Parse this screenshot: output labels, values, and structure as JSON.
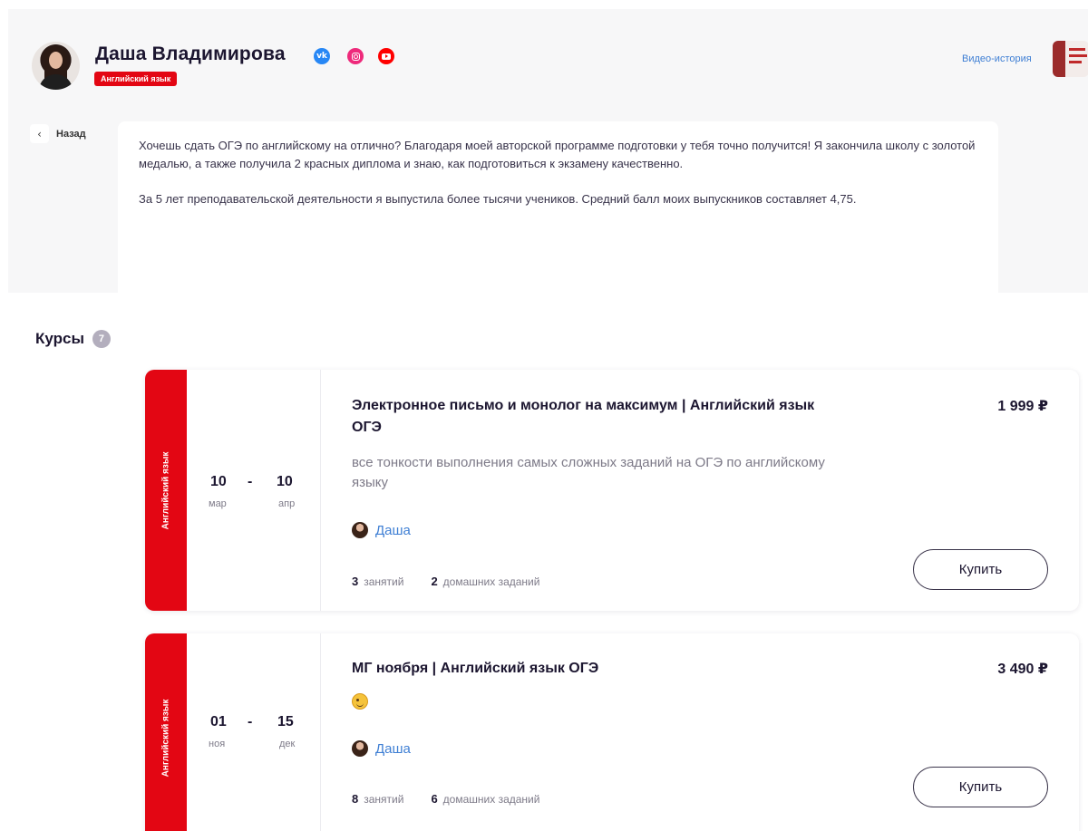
{
  "profile": {
    "name": "Даша Владимирова",
    "subject_tag": "Английский язык",
    "video_link": "Видео-история",
    "back_label": "Назад",
    "socials": [
      {
        "icon": "vk-icon",
        "color": "#2787f5"
      },
      {
        "icon": "instagram-icon",
        "color": "#ee2a7b"
      },
      {
        "icon": "youtube-icon",
        "color": "#ff0000"
      }
    ],
    "bio": [
      "Хочешь сдать ОГЭ по английскому на отлично? Благодаря моей авторской программе подготовки у тебя точно получится! Я закончила школу с золотой медалью, а также получила 2 красных диплома и знаю, как подготовиться к экзамену качественно.",
      "За 5 лет преподавательской деятельности я выпустила более тысячи учеников. Средний балл моих выпускников составляет 4,75."
    ]
  },
  "courses": {
    "title": "Курсы",
    "count": "7",
    "items": [
      {
        "subject": "Английский язык",
        "start_day": "10",
        "start_month": "мар",
        "dash": "-",
        "end_day": "10",
        "end_month": "апр",
        "title": "Электронное письмо и монолог на максимум | Английский язык ОГЭ",
        "price": "1 999 ₽",
        "description": "все тонкости выполнения самых сложных заданий на ОГЭ по английскому языку",
        "author": "Даша",
        "lessons_count": "3",
        "lessons_label": "занятий",
        "homework_count": "2",
        "homework_label": "домашних заданий",
        "buy_label": "Купить"
      },
      {
        "subject": "Английский язык",
        "start_day": "01",
        "start_month": "ноя",
        "dash": "-",
        "end_day": "15",
        "end_month": "дек",
        "title": "МГ ноября | Английский язык ОГЭ",
        "price": "3 490 ₽",
        "description_icon": "winking-face-emoji",
        "author": "Даша",
        "lessons_count": "8",
        "lessons_label": "занятий",
        "homework_count": "6",
        "homework_label": "домашних заданий",
        "buy_label": "Купить"
      }
    ]
  },
  "colors": {
    "accent_red": "#e30613",
    "link_blue": "#3f7fd4",
    "text_dark": "#1c1630"
  }
}
